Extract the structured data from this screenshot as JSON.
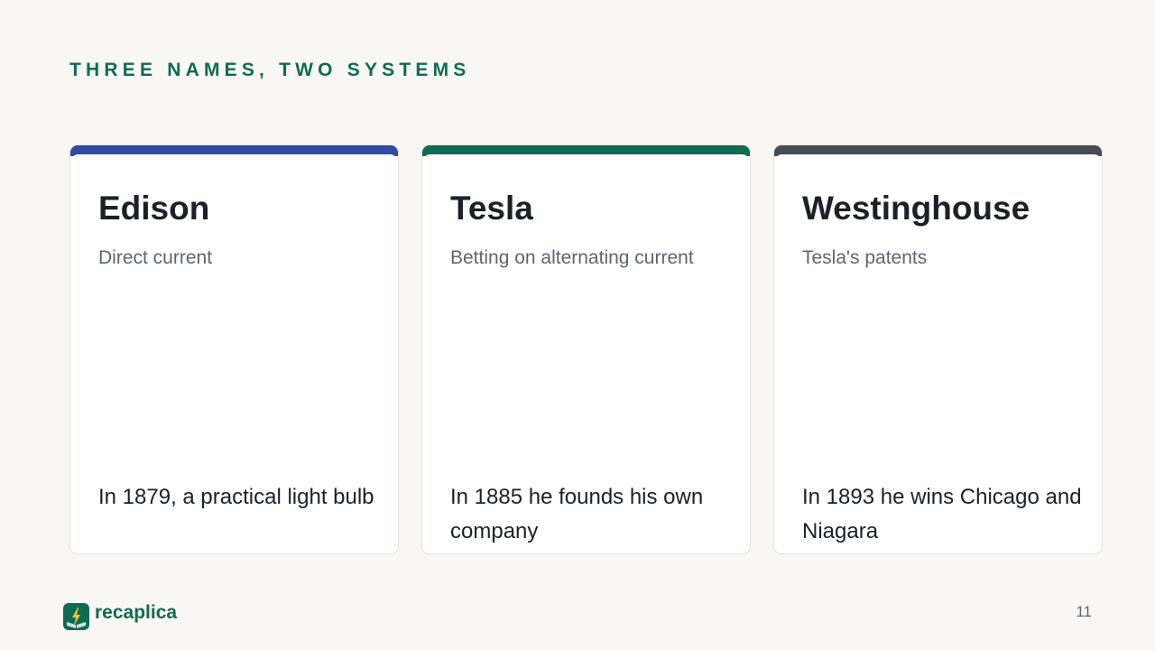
{
  "eyebrow": "THREE NAMES, TWO SYSTEMS",
  "cards": [
    {
      "title": "Edison",
      "subtitle": "Direct current",
      "footnote": "In 1879, a practical light bulb",
      "accent": "#2e4ca0"
    },
    {
      "title": "Tesla",
      "subtitle": "Betting on alternating current",
      "footnote": "In 1885 he founds his own company",
      "accent": "#0f6b52"
    },
    {
      "title": "Westinghouse",
      "subtitle": "Tesla's patents",
      "footnote": "In 1893 he wins Chicago and Niagara",
      "accent": "#454c53"
    }
  ],
  "brand": {
    "name": "recaplica",
    "icon": "lightning-book-icon",
    "color": "#0f6b52"
  },
  "page_number": "11"
}
